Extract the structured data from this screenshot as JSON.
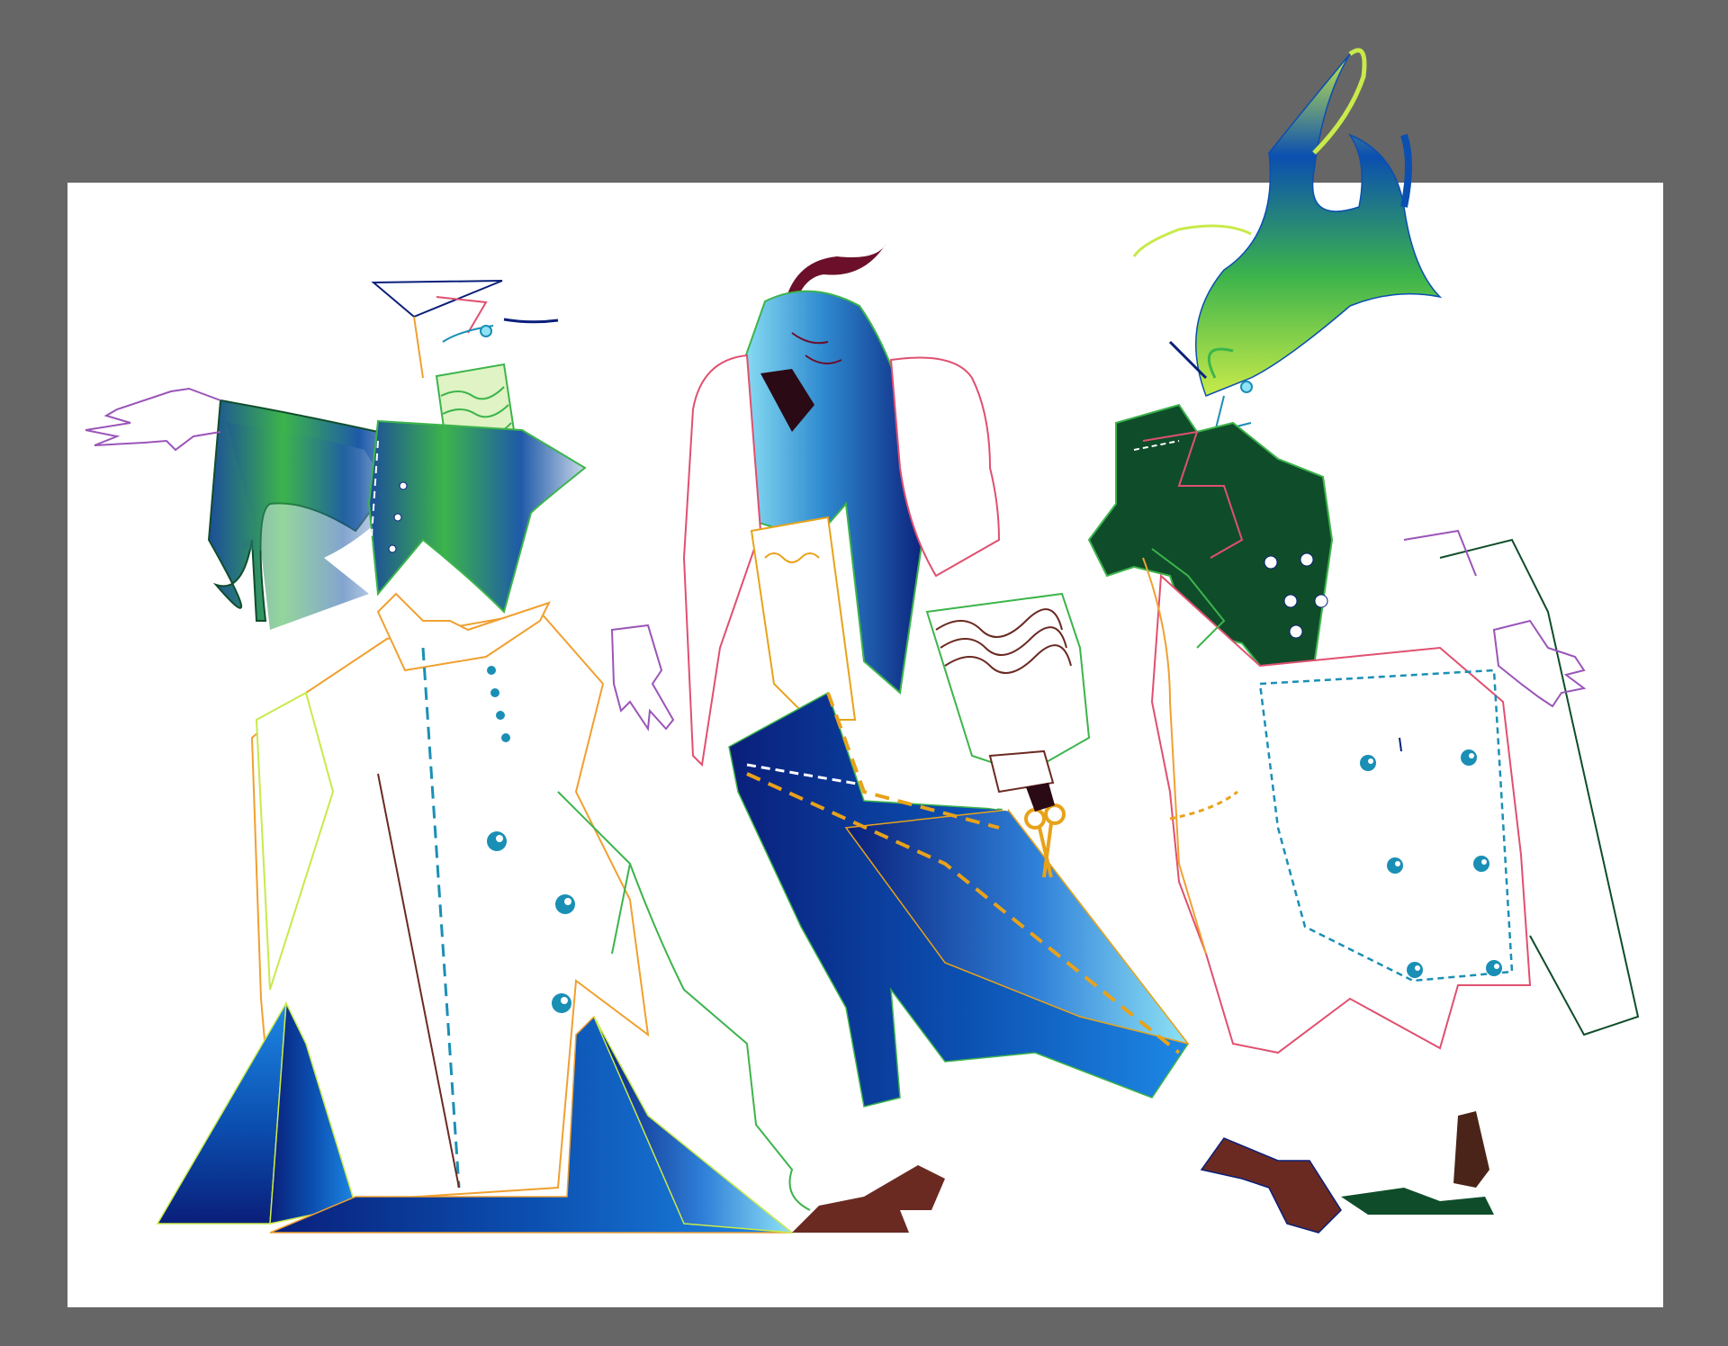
{
  "canvas": {
    "background_color": "#666666",
    "artboard_color": "#ffffff"
  },
  "palette": {
    "deep_blue": "#0a1f7a",
    "royal_blue": "#0b4fb0",
    "bright_blue": "#1e88e5",
    "sky_blue": "#8fe3f5",
    "teal": "#1a8fb5",
    "green": "#3cb44b",
    "lime": "#c8ea4a",
    "dark_green": "#0f4d2a",
    "maroon": "#6b0f2a",
    "brown": "#6a2a22",
    "mustard": "#e8a21a",
    "outline_orange": "#f0a030",
    "outline_pink": "#e05070",
    "outline_purple": "#9a55b8"
  },
  "figures": [
    {
      "name": "figure-left",
      "hat": "straw-brimmed-hat",
      "coat": "long-white-trench-coat",
      "skirt": "pleated-blue-skirt",
      "jacket": "green-blue-bolero"
    },
    {
      "name": "figure-center",
      "hat": "sky-blue-hood",
      "coat": "white-ruffled-blouse",
      "skirt": "diagonal-blue-skirt",
      "accessory": "scissors-icon"
    },
    {
      "name": "figure-right",
      "hat": "green-feather-headpiece",
      "coat": "double-breasted-white-coat",
      "jacket": "dark-green-waistcoat"
    }
  ]
}
